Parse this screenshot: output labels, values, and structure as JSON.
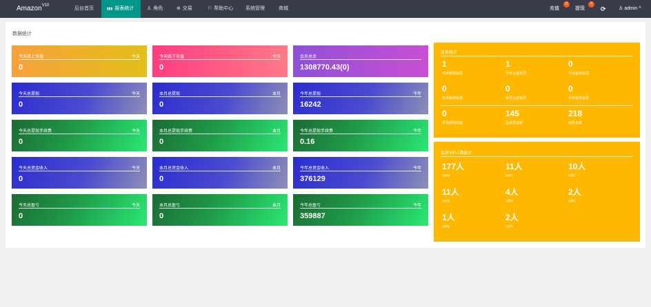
{
  "topbar": {
    "logo": "Amazon",
    "logo_sup": "V10",
    "nav": [
      {
        "label": "后台首页",
        "icon": ""
      },
      {
        "label": "报表统计",
        "icon": "▮▮▮"
      },
      {
        "label": "角色",
        "icon": "♙"
      },
      {
        "label": "交易",
        "icon": "⊕"
      },
      {
        "label": "帮助中心",
        "icon": "⚐"
      },
      {
        "label": "系统管理",
        "icon": ""
      },
      {
        "label": "商城",
        "icon": ""
      }
    ],
    "recharge": {
      "label": "充值",
      "badge": "0"
    },
    "withdraw": {
      "label": "提现",
      "badge": "0"
    },
    "refresh_icon": "⟳",
    "user": {
      "icon": "♙",
      "name": "admin",
      "caret": "^"
    }
  },
  "panel_title": "数据统计",
  "cards": [
    {
      "title": "今天线上充值",
      "tag": "今天",
      "value": "0"
    },
    {
      "title": "今天线下充值",
      "tag": "今天",
      "value": "0"
    },
    {
      "title": "会员总余",
      "tag": "",
      "value": "1308770.43(0)"
    },
    {
      "title": "今天总提现",
      "tag": "今天",
      "value": "0"
    },
    {
      "title": "本月总提现",
      "tag": "本月",
      "value": "0"
    },
    {
      "title": "今年总提现",
      "tag": "今年",
      "value": "16242"
    },
    {
      "title": "今天总提现手续费",
      "tag": "今天",
      "value": "0"
    },
    {
      "title": "本月总提现手续费",
      "tag": "本月",
      "value": "0"
    },
    {
      "title": "今年总提现手续费",
      "tag": "今年",
      "value": "0.16"
    },
    {
      "title": "今天总资金收入",
      "tag": "今天",
      "value": "0"
    },
    {
      "title": "本月总资金收入",
      "tag": "本月",
      "value": "0"
    },
    {
      "title": "今年总资金收入",
      "tag": "今年",
      "value": "376129"
    },
    {
      "title": "今天总盈亏",
      "tag": "今天",
      "value": "0"
    },
    {
      "title": "本月总盈亏",
      "tag": "本月",
      "value": "0"
    },
    {
      "title": "今年总盈亏",
      "tag": "今年",
      "value": "359887"
    }
  ],
  "member": {
    "title": "会员统计",
    "stats": [
      {
        "value": "1",
        "label": "今天新增会员"
      },
      {
        "value": "1",
        "label": "今天认证会员"
      },
      {
        "value": "0",
        "label": "今天首充会员"
      },
      {
        "value": "0",
        "label": "本月新增会员"
      },
      {
        "value": "0",
        "label": "本月认证会员"
      },
      {
        "value": "0",
        "label": "今天首充会员"
      },
      {
        "value": "0",
        "label": "本月新增充值"
      },
      {
        "value": "145",
        "label": "总会员总数"
      },
      {
        "value": "218",
        "label": "会员总数"
      }
    ]
  },
  "vip": {
    "title": "会员VIP人数统计",
    "stats": [
      {
        "value": "177人",
        "label": "VIP0"
      },
      {
        "value": "11人",
        "label": "VIP1"
      },
      {
        "value": "10人",
        "label": "VIP2"
      },
      {
        "value": "11人",
        "label": "VIP3"
      },
      {
        "value": "4人",
        "label": "VIP4"
      },
      {
        "value": "2人",
        "label": "VIP5"
      },
      {
        "value": "1人",
        "label": "VIP6"
      },
      {
        "value": "2人",
        "label": "VIP7"
      }
    ]
  }
}
